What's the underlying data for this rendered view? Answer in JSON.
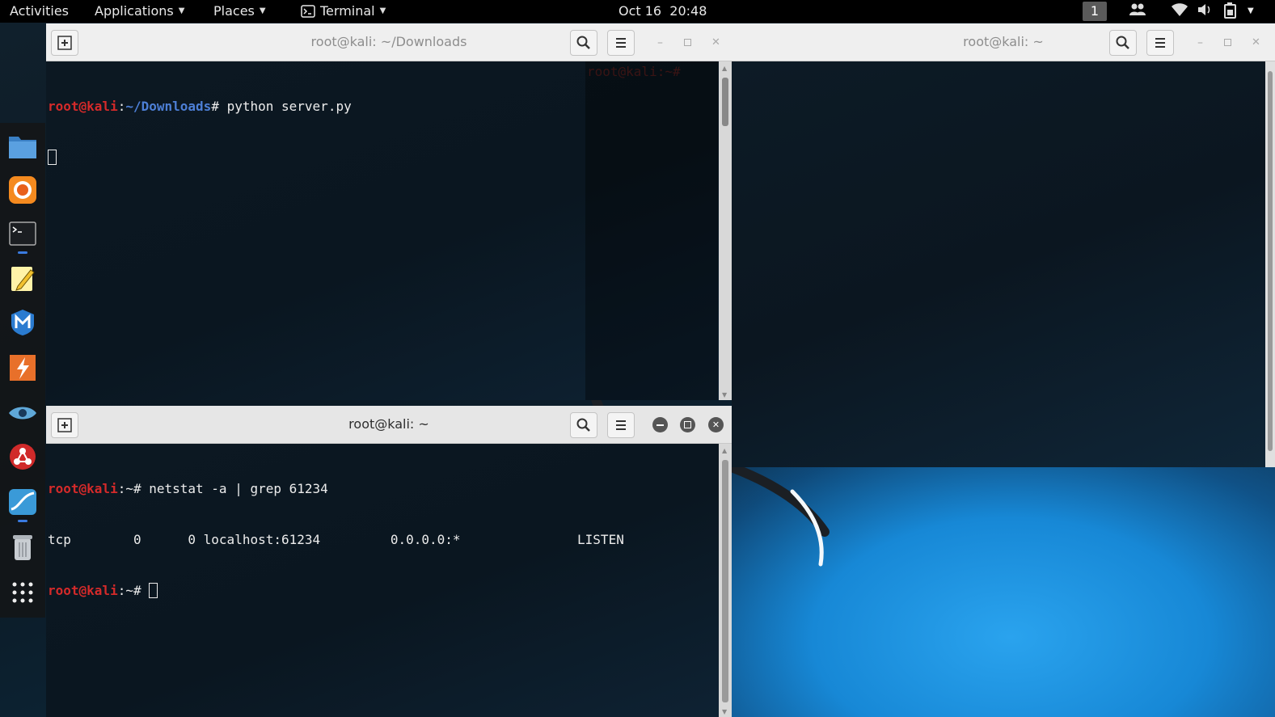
{
  "topbar": {
    "activities": "Activities",
    "applications": "Applications",
    "places": "Places",
    "terminal": "Terminal",
    "clock": "Oct 16  20:48",
    "workspace": "1"
  },
  "dock": {
    "items": [
      "files",
      "firefox",
      "terminal",
      "text-editor",
      "metasploit",
      "burp-suite",
      "eye",
      "maltego",
      "wireshark",
      "trash",
      "show-apps"
    ]
  },
  "win_top_left": {
    "title": "root@kali: ~/Downloads",
    "prompt_user": "root@kali",
    "prompt_sep": ":",
    "prompt_path": "~/Downloads",
    "prompt_end": "#",
    "command": " python server.py"
  },
  "win_bottom_left": {
    "title": "root@kali: ~",
    "line1_user": "root@kali",
    "line1_rest": ":~# netstat -a | grep 61234",
    "line2": "tcp        0      0 localhost:61234         0.0.0.0:*               LISTEN",
    "line3_user": "root@kali",
    "line3_rest": ":~# "
  },
  "win_right": {
    "title": "root@kali: ~"
  },
  "ghost_prompt": "root@kali:~# ",
  "colors": {
    "prompt_red": "#d42a2a",
    "path_blue": "#4d7fd6",
    "accent": "#3a7be0"
  }
}
